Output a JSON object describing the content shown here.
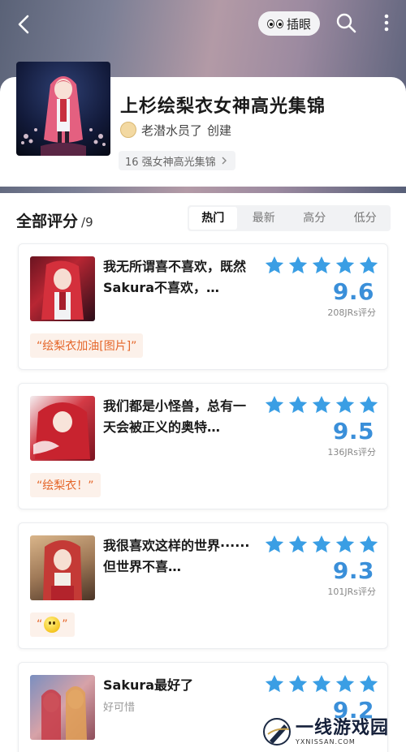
{
  "topbar": {
    "peek_label": "插眼"
  },
  "collection": {
    "title": "上杉绘梨衣女神高光集锦",
    "creator_name": "老潜水员了",
    "creator_suffix": "创建",
    "tag": "16 强女神高光集锦"
  },
  "reviews": {
    "title": "全部评分",
    "count": "/9",
    "tabs": [
      "热门",
      "最新",
      "高分",
      "低分"
    ],
    "active_tab": "热门",
    "star_color": "#3a9ee4",
    "items": [
      {
        "title": "我无所谓喜不喜欢，既然Sakura不喜欢，…",
        "score": "9.6",
        "votes": "208JRs评分",
        "stars": 5,
        "quote": "“绘梨衣加油[图片]”"
      },
      {
        "title": "我们都是小怪兽，总有一天会被正义的奥特…",
        "score": "9.5",
        "votes": "136JRs评分",
        "stars": 5,
        "quote": "“绘梨衣！”"
      },
      {
        "title": "我很喜欢这样的世界······但世界不喜…",
        "score": "9.3",
        "votes": "101JRs评分",
        "stars": 5,
        "quote_open": "“",
        "quote_close": "”"
      },
      {
        "title": "Sakura最好了",
        "subtitle": "好可惜",
        "score": "9.2",
        "stars": 5
      }
    ]
  },
  "watermark": {
    "name": "一线游戏园",
    "url": "YXNISSAN.COM"
  }
}
